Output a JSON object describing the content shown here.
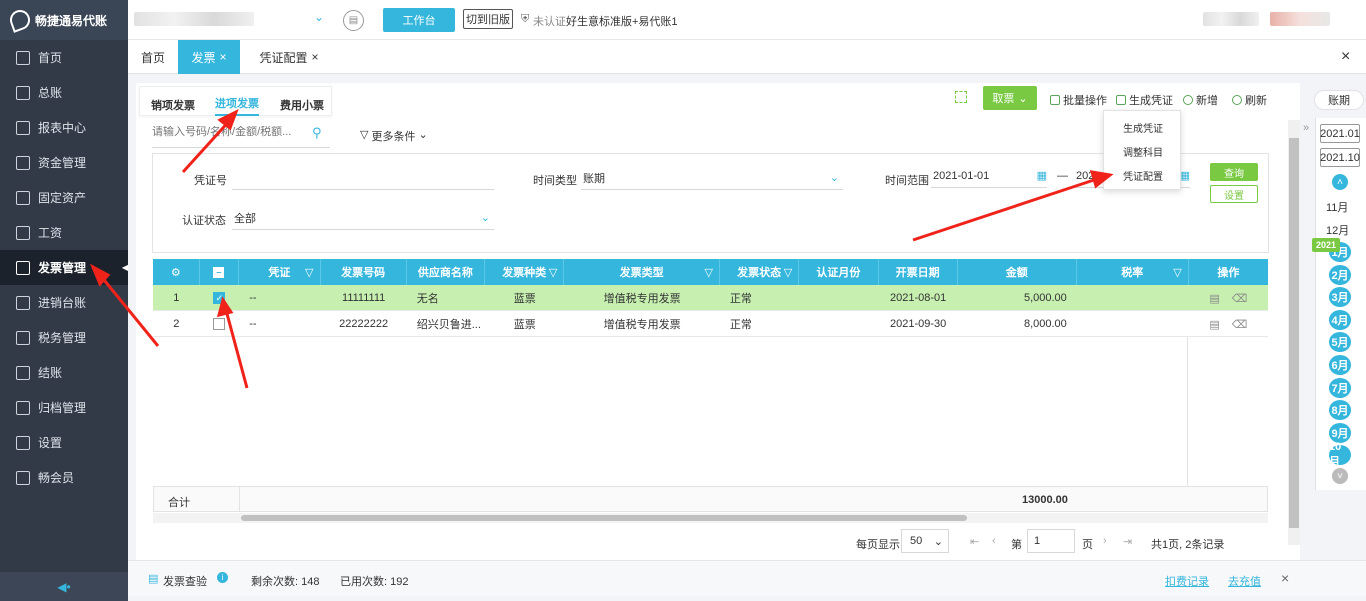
{
  "app": {
    "logo_text": "畅捷通易代账"
  },
  "topbar": {
    "workbench_label": "工作台",
    "switch_old_label": "切到旧版",
    "cert_text": "未认证",
    "product_text": "好生意标准版+易代账1"
  },
  "sidebar": {
    "items": [
      {
        "label": "首页",
        "icon": "home-icon"
      },
      {
        "label": "总账",
        "icon": "ledger-icon"
      },
      {
        "label": "报表中心",
        "icon": "report-icon"
      },
      {
        "label": "资金管理",
        "icon": "fund-icon"
      },
      {
        "label": "固定资产",
        "icon": "asset-icon"
      },
      {
        "label": "工资",
        "icon": "salary-icon"
      },
      {
        "label": "发票管理",
        "icon": "invoice-icon",
        "active": true
      },
      {
        "label": "进销台账",
        "icon": "inventory-icon"
      },
      {
        "label": "税务管理",
        "icon": "tax-icon"
      },
      {
        "label": "结账",
        "icon": "close-account-icon"
      },
      {
        "label": "归档管理",
        "icon": "archive-icon"
      },
      {
        "label": "设置",
        "icon": "gear-icon"
      },
      {
        "label": "畅会员",
        "icon": "vip-icon"
      }
    ]
  },
  "tabs": [
    {
      "label": "首页"
    },
    {
      "label": "发票"
    },
    {
      "label": "凭证配置"
    }
  ],
  "subtabs": [
    {
      "label": "销项发票"
    },
    {
      "label": "进项发票"
    },
    {
      "label": "费用小票"
    }
  ],
  "toolbar": {
    "fetch_label": "取票",
    "batch_label": "批量操作",
    "gen_voucher_label": "生成凭证",
    "add_label": "新增",
    "refresh_label": "刷新"
  },
  "dropdown": {
    "items": [
      "生成凭证",
      "调整科目",
      "凭证配置"
    ]
  },
  "search": {
    "placeholder": "请输入号码/名称/金额/税额...",
    "more_label": "更多条件"
  },
  "filters": {
    "voucher_no_label": "凭证号",
    "voucher_no_value": "",
    "time_type_label": "时间类型",
    "time_type_value": "账期",
    "time_range_label": "时间范围",
    "date_from": "2021-01-01",
    "date_sep": "—",
    "date_to": "2021-",
    "cert_status_label": "认证状态",
    "cert_status_value": "全部",
    "query_label": "查询",
    "settings_label": "设置"
  },
  "table": {
    "headers": [
      "凭证",
      "发票号码",
      "供应商名称",
      "发票种类",
      "发票类型",
      "发票状态",
      "认证月份",
      "开票日期",
      "金额",
      "税率",
      "操作"
    ],
    "rows": [
      {
        "index": "1",
        "voucher": "--",
        "invoice_no": "11111111",
        "supplier": "无名",
        "kind": "蓝票",
        "type": "增值税专用发票",
        "status": "正常",
        "cert_month": "",
        "date": "2021-08-01",
        "amount": "5,000.00",
        "rate": "",
        "checked": true
      },
      {
        "index": "2",
        "voucher": "--",
        "invoice_no": "22222222",
        "supplier": "绍兴贝鲁进...",
        "kind": "蓝票",
        "type": "增值税专用发票",
        "status": "正常",
        "cert_month": "",
        "date": "2021-09-30",
        "amount": "8,000.00",
        "rate": "",
        "checked": false
      }
    ],
    "total_label": "合计",
    "total_amount": "13000.00"
  },
  "pagination": {
    "per_page_label": "每页显示",
    "per_page": "50",
    "page_label_pre": "第",
    "page": "1",
    "page_label_post": "页",
    "summary": "共1页, 2条记录"
  },
  "right_panel": {
    "tab_label": "账期",
    "year_from": "2021.01",
    "year_to": "2021.10",
    "months_prev": [
      "11月",
      "12月"
    ],
    "year_badge": "2021",
    "months": [
      "1月",
      "2月",
      "3月",
      "4月",
      "5月",
      "6月",
      "7月",
      "8月",
      "9月",
      "10月"
    ]
  },
  "footer": {
    "check_label": "发票查验",
    "remaining": "剩余次数: 148",
    "used": "已用次数: 192",
    "deduct_label": "扣费记录",
    "recharge_label": "去充值"
  },
  "colors": {
    "accent": "#35b6dc",
    "sidebar": "#323a48",
    "green": "#7ac943",
    "row_selected": "#c6efb0",
    "arrow": "#f0231b"
  }
}
